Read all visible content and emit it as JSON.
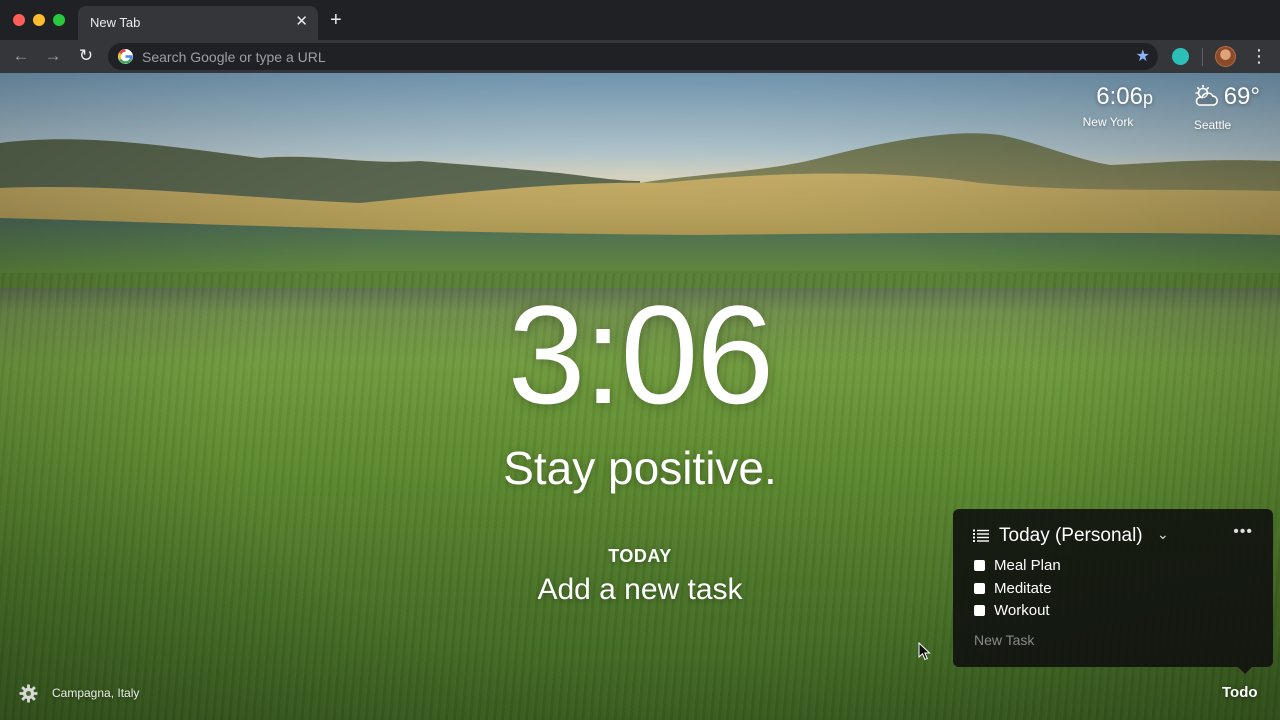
{
  "browser": {
    "tab_title": "New Tab",
    "tab_close": "✕",
    "new_tab": "+",
    "omnibox_placeholder": "Search Google or type a URL",
    "back": "←",
    "forward": "→",
    "reload": "↻",
    "menu": "⋮",
    "bookmark_star": "★"
  },
  "widgets": {
    "time": "6:06",
    "time_suffix": "p",
    "time_city": "New York",
    "temperature": "69°",
    "weather_city": "Seattle",
    "weather_icon": "partly-cloudy-icon"
  },
  "main": {
    "clock": "3:06",
    "mantra": "Stay positive.",
    "focus_label": "TODAY",
    "focus_prompt": "Add a new task"
  },
  "todo": {
    "list_title": "Today (Personal)",
    "more": "•••",
    "chevron": "⌄",
    "items": [
      {
        "label": "Meal Plan",
        "done": false
      },
      {
        "label": "Meditate",
        "done": false
      },
      {
        "label": "Workout",
        "done": false
      }
    ],
    "new_task_placeholder": "New Task",
    "toggle_label": "Todo"
  },
  "footer": {
    "photo_location": "Campagna, Italy"
  },
  "colors": {
    "chrome_dark": "#202124",
    "chrome_toolbar": "#35363a",
    "accent_star": "#8ab4f8",
    "extension_teal": "#2bbfb7"
  }
}
